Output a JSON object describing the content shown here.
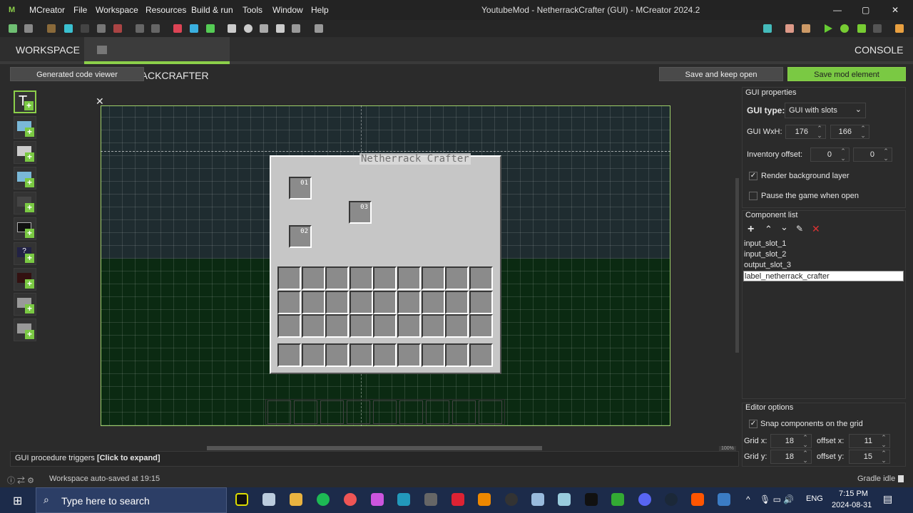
{
  "window": {
    "title": "YoutubeMod - NetherrackCrafter (GUI) - MCreator 2024.2",
    "minimize": "—",
    "maximize": "▢",
    "close": "✕"
  },
  "menu": [
    "MCreator",
    "File",
    "Workspace",
    "Resources",
    "Build & run",
    "Tools",
    "Window",
    "Help"
  ],
  "tabs": {
    "workspace": "WORKSPACE",
    "active": "NETHERRACKCRAFTER",
    "close": "✕",
    "console": "CONSOLE"
  },
  "buttons": {
    "code_viewer": "Generated code viewer",
    "save_keep": "Save and keep open",
    "save": "Save mod element"
  },
  "colors": {
    "accent": "#8cd04a",
    "save_bg": "#7ac943"
  },
  "gui": {
    "label": "Netherrack Crafter",
    "slots": [
      "01",
      "02",
      "03"
    ]
  },
  "properties": {
    "title": "GUI properties",
    "type_label": "GUI type:",
    "type_value": "GUI with slots",
    "wh_label": "GUI WxH:",
    "width": "176",
    "height": "166",
    "inv_label": "Inventory offset:",
    "inv_x": "0",
    "inv_y": "0",
    "render_bg": "Render background layer",
    "render_bg_checked": true,
    "pause": "Pause the game when open",
    "pause_checked": false
  },
  "components": {
    "title": "Component list",
    "items": [
      "input_slot_1",
      "input_slot_2",
      "output_slot_3",
      "label_netherrack_crafter"
    ],
    "selected": 3
  },
  "editor": {
    "title": "Editor options",
    "snap": "Snap components on the grid",
    "grid_x_label": "Grid x:",
    "grid_x": "18",
    "offset_x_label": "offset x:",
    "offset_x": "11",
    "grid_y_label": "Grid y:",
    "grid_y": "18",
    "offset_y_label": "offset y:",
    "offset_y": "15"
  },
  "zoom": "100%",
  "triggers": {
    "label": "GUI procedure triggers ",
    "expand": "[Click to expand]"
  },
  "status": {
    "left": "Workspace auto-saved at 19:15",
    "right": "Gradle idle"
  },
  "taskbar": {
    "search": "Type here to search",
    "lang": "ENG",
    "time": "7:15 PM",
    "date": "2024-08-31"
  }
}
